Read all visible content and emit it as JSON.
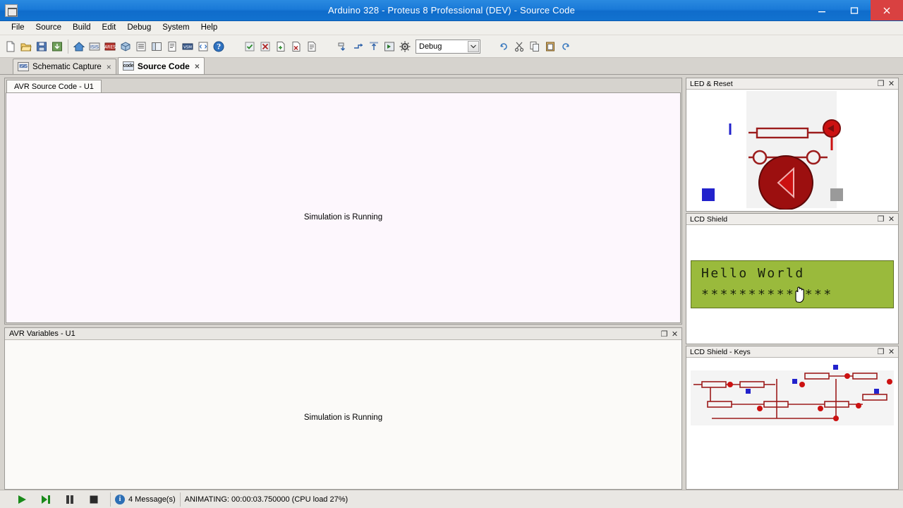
{
  "window": {
    "title": "Arduino 328 - Proteus 8 Professional (DEV) - Source Code",
    "app_icon": "proteus-icon",
    "minimize_label": "Minimize",
    "maximize_label": "Restore",
    "close_label": "Close"
  },
  "menu": {
    "items": [
      {
        "label": "File"
      },
      {
        "label": "Source"
      },
      {
        "label": "Build"
      },
      {
        "label": "Edit"
      },
      {
        "label": "Debug"
      },
      {
        "label": "System"
      },
      {
        "label": "Help"
      }
    ]
  },
  "toolbar": {
    "groups": [
      {
        "buttons": [
          {
            "name": "new-project-icon",
            "glyph": "new"
          },
          {
            "name": "open-project-icon",
            "glyph": "open"
          },
          {
            "name": "save-project-icon",
            "glyph": "save"
          },
          {
            "name": "import-project-icon",
            "glyph": "import"
          }
        ]
      },
      {
        "buttons": [
          {
            "name": "home-icon",
            "glyph": "home"
          },
          {
            "name": "schematic-capture-icon",
            "glyph": "isis"
          },
          {
            "name": "pcb-layout-icon",
            "glyph": "ares"
          },
          {
            "name": "3d-visualizer-icon",
            "glyph": "3d"
          },
          {
            "name": "bill-of-materials-icon",
            "glyph": "bom"
          },
          {
            "name": "design-explorer-icon",
            "glyph": "explorer"
          },
          {
            "name": "project-notes-icon",
            "glyph": "notes"
          },
          {
            "name": "vsm-studio-icon",
            "glyph": "vsm"
          },
          {
            "name": "source-code-icon",
            "glyph": "source"
          },
          {
            "name": "help-icon",
            "glyph": "help"
          }
        ]
      },
      {
        "buttons": [
          {
            "name": "build-project-icon",
            "glyph": "build"
          },
          {
            "name": "clean-project-icon",
            "glyph": "clean"
          },
          {
            "name": "add-file-icon",
            "glyph": "addfile"
          },
          {
            "name": "remove-file-icon",
            "glyph": "removefile"
          },
          {
            "name": "new-source-file-icon",
            "glyph": "newsource"
          }
        ]
      },
      {
        "buttons": [
          {
            "name": "step-into-icon",
            "glyph": "stepinto"
          },
          {
            "name": "step-over-icon",
            "glyph": "stepover"
          },
          {
            "name": "step-out-icon",
            "glyph": "stepout"
          },
          {
            "name": "run-to-cursor-icon",
            "glyph": "runcursor"
          },
          {
            "name": "settings-icon",
            "glyph": "gear"
          }
        ]
      },
      {
        "buttons": [
          {
            "name": "undo-icon",
            "glyph": "undo"
          },
          {
            "name": "cut-icon",
            "glyph": "cut"
          },
          {
            "name": "copy-icon",
            "glyph": "copy"
          },
          {
            "name": "paste-icon",
            "glyph": "paste"
          },
          {
            "name": "redo-icon",
            "glyph": "redo"
          }
        ]
      }
    ],
    "build_config": {
      "label": "Debug",
      "name": "build-configuration-select"
    }
  },
  "tabs": [
    {
      "label": "Schematic Capture",
      "icon": "isis-icon",
      "active": false,
      "close": "×"
    },
    {
      "label": "Source Code",
      "icon": "source-icon",
      "active": true,
      "close": "×"
    }
  ],
  "source_pane": {
    "tab_label": "AVR Source Code - U1",
    "status_text": "Simulation is Running"
  },
  "variables_pane": {
    "title": "AVR Variables - U1",
    "status_text": "Simulation is Running",
    "restore_glyph": "❐",
    "close_glyph": "✕"
  },
  "right_panels": [
    {
      "title": "LED & Reset",
      "name": "panel-led-and-reset",
      "restore_glyph": "❐",
      "close_glyph": "✕",
      "content": "schematic-led-reset"
    },
    {
      "title": "LCD Shield",
      "name": "panel-lcd-shield",
      "restore_glyph": "❐",
      "close_glyph": "✕",
      "content": "lcd-display"
    },
    {
      "title": "LCD Shield - Keys",
      "name": "panel-lcd-shield-keys",
      "restore_glyph": "❐",
      "close_glyph": "✕",
      "content": "schematic-keys"
    }
  ],
  "lcd": {
    "line1": "Hello World",
    "line2": "**************",
    "background_color": "#9aba3c",
    "text_color": "#18200c"
  },
  "statusbar": {
    "play_label": "Run simulation",
    "step_label": "Step simulation",
    "pause_label": "Pause simulation",
    "stop_label": "Stop simulation",
    "messages": "4 Message(s)",
    "animating": "ANIMATING: 00:00:03.750000 (CPU load 27%)"
  },
  "colors": {
    "title_bar": "#1a7ad8",
    "close_button": "#d94141",
    "chrome": "#f0efeb",
    "desktop": "#d6d3ce",
    "code_bg": "#fdf7fd",
    "lcd_green": "#9aba3c",
    "schematic_red": "#9c1c1c",
    "schematic_blue": "#2222cc"
  }
}
